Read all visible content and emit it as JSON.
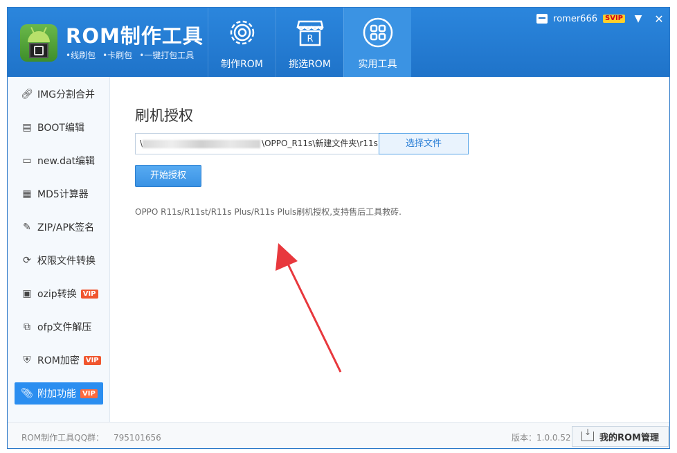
{
  "app": {
    "title": "ROM制作工具",
    "subtitle_items": [
      "•线刷包",
      "•卡刷包",
      "•一键打包工具"
    ]
  },
  "tabs": [
    {
      "label": "制作ROM",
      "icon": "gear-icon",
      "active": false
    },
    {
      "label": "挑选ROM",
      "icon": "store-icon",
      "active": false
    },
    {
      "label": "实用工具",
      "icon": "grid-icon",
      "active": true
    }
  ],
  "user": {
    "name": "romer666",
    "badge": "SVIP"
  },
  "window_controls": {
    "menu": "▼",
    "close": "✕"
  },
  "sidebar": {
    "items": [
      {
        "label": "IMG分割合并",
        "icon": "link-icon",
        "vip": ""
      },
      {
        "label": "BOOT编辑",
        "icon": "document-icon",
        "vip": ""
      },
      {
        "label": "new.dat编辑",
        "icon": "folder-icon",
        "vip": ""
      },
      {
        "label": "MD5计算器",
        "icon": "calculator-icon",
        "vip": ""
      },
      {
        "label": "ZIP/APK签名",
        "icon": "edit-icon",
        "vip": ""
      },
      {
        "label": "权限文件转换",
        "icon": "refresh-icon",
        "vip": ""
      },
      {
        "label": "ozip转换",
        "icon": "file-convert-icon",
        "vip": "VIP"
      },
      {
        "label": "ofp文件解压",
        "icon": "extract-icon",
        "vip": ""
      },
      {
        "label": "ROM加密",
        "icon": "shield-icon",
        "vip": "VIP"
      },
      {
        "label": "附加功能",
        "icon": "paperclip-icon",
        "vip": "VIP",
        "active": true
      }
    ]
  },
  "main": {
    "title": "刷机授权",
    "path_value": "\\OPPO_R11s\\新建文件夹\\r11s",
    "path_prefix": "\\",
    "choose_label": "选择文件",
    "start_label": "开始授权",
    "description": "OPPO R11s/R11st/R11s Plus/R11s Pluls刷机授权,支持售后工具救砖."
  },
  "footer": {
    "qq_label": "ROM制作工具QQ群：",
    "qq_number": "795101656",
    "version_label": "版本：1.0.0.52",
    "my_rom_label": "我的ROM管理"
  },
  "colors": {
    "header": "#1f73c9",
    "active_tab": "#3b93e3",
    "sidebar_active": "#2b8ef0",
    "vip": "#f0562f",
    "arrow": "#e8383d"
  }
}
